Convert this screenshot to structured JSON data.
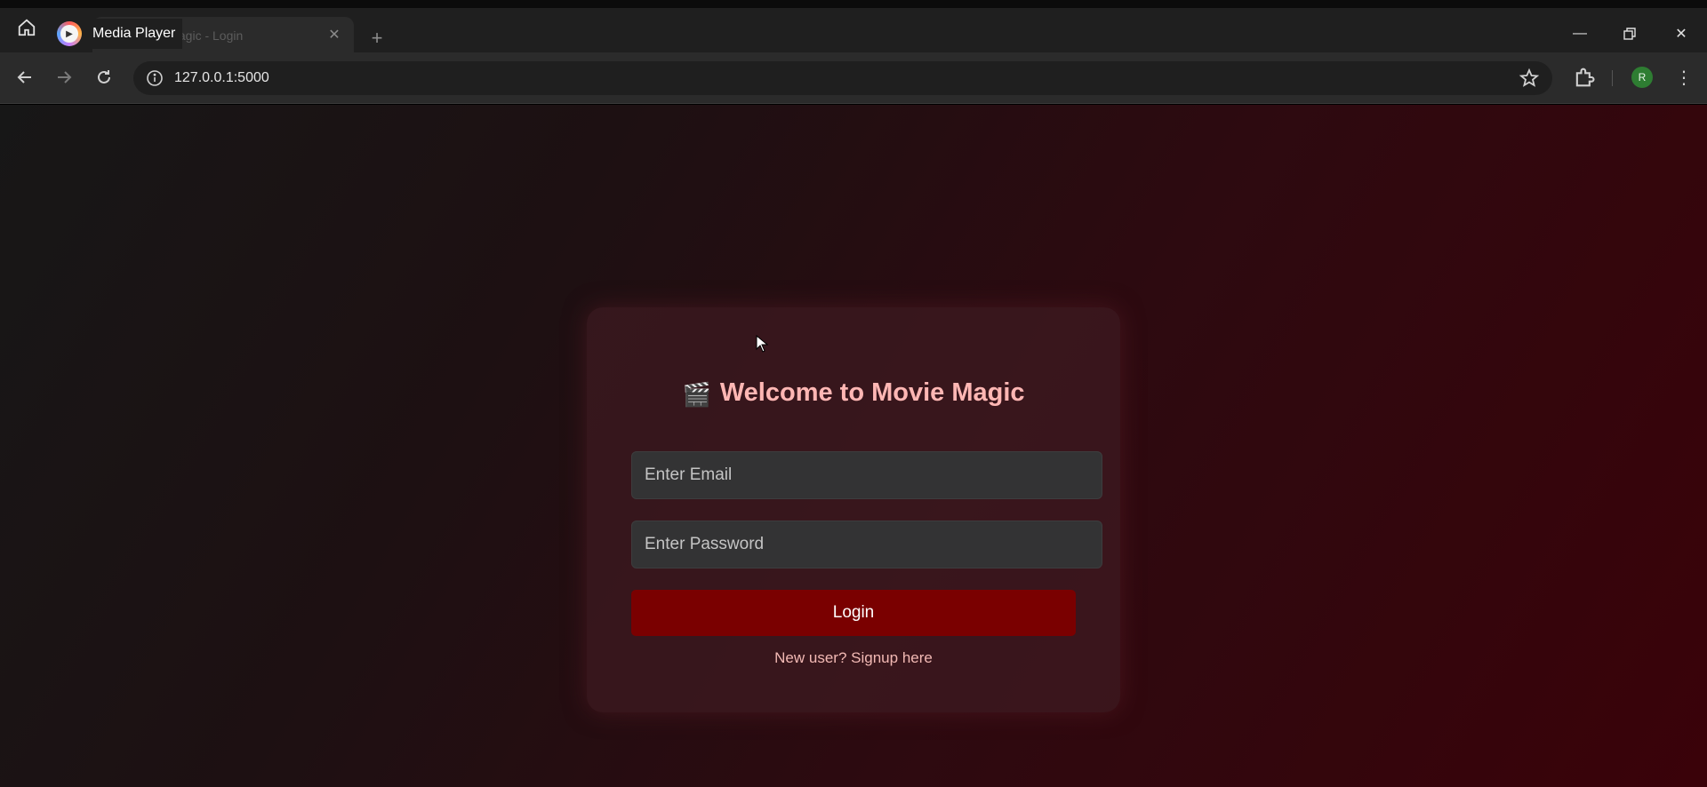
{
  "browser": {
    "tab_title": "Movie Magic - Login",
    "url": "127.0.0.1:5000",
    "profile_initial": "R",
    "overlay_app_title": "Media Player"
  },
  "page": {
    "heading_icon": "🎬",
    "heading": "Welcome to Movie Magic",
    "email_placeholder": "Enter Email",
    "password_placeholder": "Enter Password",
    "login_label": "Login",
    "signup_prompt": "New user?",
    "signup_link": "Signup here"
  },
  "colors": {
    "accent_button": "#7a0000",
    "heading_text": "#ffb7b4",
    "background_dark": "#171717",
    "background_red": "#3a0209"
  },
  "icons": [
    "home-icon",
    "media-player-icon",
    "close-icon",
    "new-tab-icon",
    "minimize-icon",
    "restore-icon",
    "window-close-icon",
    "back-icon",
    "forward-icon",
    "reload-icon",
    "site-info-icon",
    "bookmark-star-icon",
    "extensions-icon",
    "menu-icon",
    "clapper-icon",
    "cursor-icon"
  ]
}
